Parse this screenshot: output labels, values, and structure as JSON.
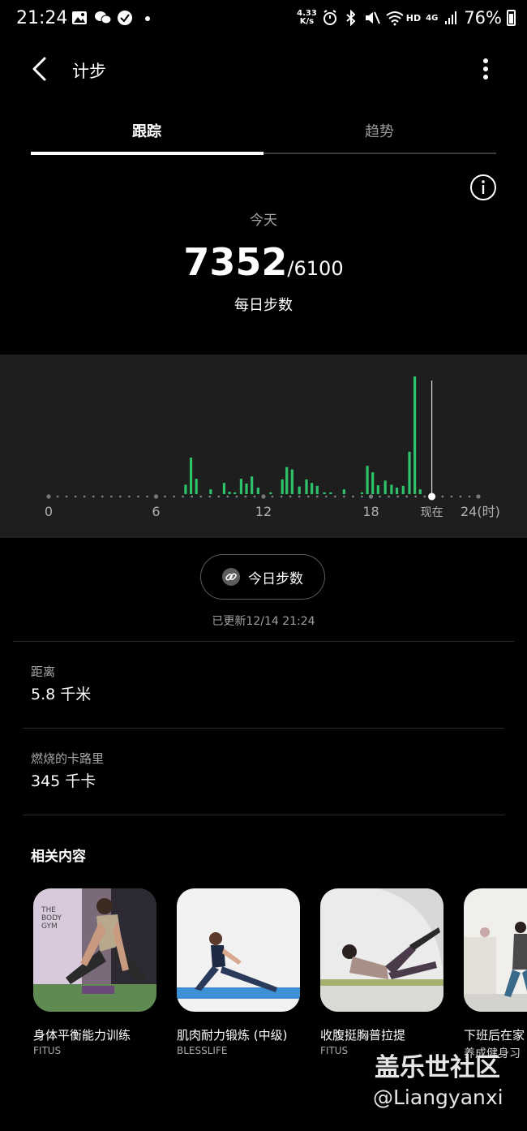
{
  "status_bar": {
    "time": "21:24",
    "speed_value": "4.33",
    "speed_unit": "K/s",
    "hd": "HD",
    "network": "4G",
    "battery": "76%"
  },
  "app_bar": {
    "title": "计步"
  },
  "tabs": [
    {
      "label": "跟踪",
      "active": true
    },
    {
      "label": "趋势",
      "active": false
    }
  ],
  "summary": {
    "period_label": "今天",
    "steps": "7352",
    "goal": "/6100",
    "caption": "每日步数"
  },
  "chart_data": {
    "type": "bar",
    "x_ticks": [
      "0",
      "6",
      "12",
      "18",
      "现在",
      "24(时)"
    ],
    "now_hour": 21.4,
    "x_range": [
      0,
      24
    ],
    "bar_color": "#2ec36a",
    "bars": [
      {
        "x": 7.65,
        "y": 80
      },
      {
        "x": 7.95,
        "y": 310
      },
      {
        "x": 8.25,
        "y": 130
      },
      {
        "x": 9.05,
        "y": 40
      },
      {
        "x": 9.8,
        "y": 95
      },
      {
        "x": 10.1,
        "y": 20
      },
      {
        "x": 10.4,
        "y": 15
      },
      {
        "x": 10.75,
        "y": 130
      },
      {
        "x": 11.05,
        "y": 90
      },
      {
        "x": 11.35,
        "y": 150
      },
      {
        "x": 11.7,
        "y": 55
      },
      {
        "x": 12.4,
        "y": 15
      },
      {
        "x": 13.05,
        "y": 125
      },
      {
        "x": 13.3,
        "y": 230
      },
      {
        "x": 13.6,
        "y": 210
      },
      {
        "x": 14.0,
        "y": 65
      },
      {
        "x": 14.4,
        "y": 125
      },
      {
        "x": 14.7,
        "y": 95
      },
      {
        "x": 15.0,
        "y": 70
      },
      {
        "x": 15.4,
        "y": 15
      },
      {
        "x": 15.75,
        "y": 15
      },
      {
        "x": 16.5,
        "y": 40
      },
      {
        "x": 17.5,
        "y": 15
      },
      {
        "x": 17.8,
        "y": 240
      },
      {
        "x": 18.1,
        "y": 185
      },
      {
        "x": 18.4,
        "y": 75
      },
      {
        "x": 18.8,
        "y": 115
      },
      {
        "x": 19.15,
        "y": 80
      },
      {
        "x": 19.45,
        "y": 55
      },
      {
        "x": 19.8,
        "y": 70
      },
      {
        "x": 20.15,
        "y": 360
      },
      {
        "x": 20.45,
        "y": 1000
      },
      {
        "x": 20.75,
        "y": 40
      }
    ]
  },
  "today_button": {
    "label": "今日步数"
  },
  "updated_text": "已更新12/14 21:24",
  "stats": [
    {
      "label": "距离",
      "value": "5.8 千米"
    },
    {
      "label": "燃烧的卡路里",
      "value": "345 千卡"
    }
  ],
  "related": {
    "title": "相关内容",
    "cards": [
      {
        "title": "身体平衡能力训练",
        "source": "FITUS",
        "image_text": "THE BODY GYM"
      },
      {
        "title": "肌肉耐力锻炼 (中级)",
        "source": "BLESSLIFE"
      },
      {
        "title": "收腹挺胸普拉提",
        "source": "FITUS"
      },
      {
        "title": "下班后在家",
        "source": "养成健身习"
      }
    ]
  },
  "watermark": {
    "line1": "盖乐世社区",
    "line2": "@Liangyanxi"
  }
}
